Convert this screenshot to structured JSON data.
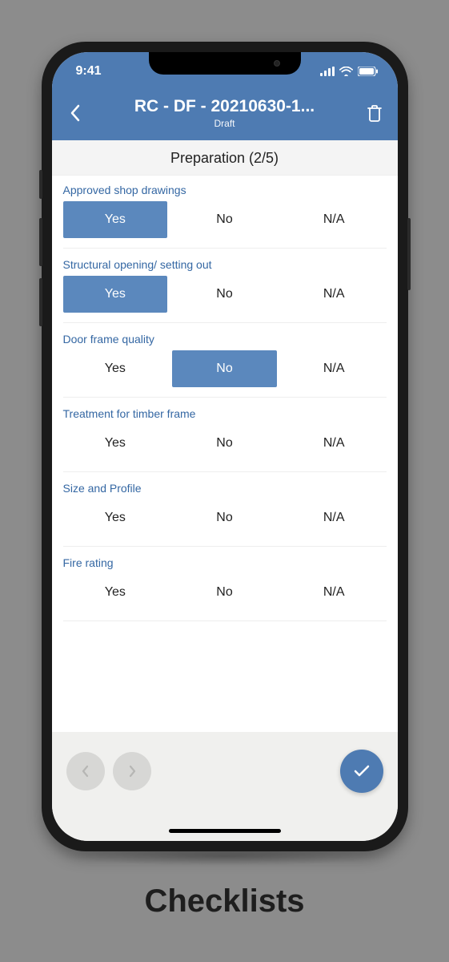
{
  "status": {
    "time": "9:41"
  },
  "header": {
    "title": "RC - DF - 20210630-1...",
    "subtitle": "Draft"
  },
  "section": {
    "title": "Preparation (2/5)"
  },
  "options": {
    "yes": "Yes",
    "no": "No",
    "na": "N/A"
  },
  "items": [
    {
      "label": "Approved shop drawings",
      "selected": "yes"
    },
    {
      "label": "Structural opening/ setting out",
      "selected": "yes"
    },
    {
      "label": "Door frame quality",
      "selected": "no"
    },
    {
      "label": "Treatment for timber frame",
      "selected": ""
    },
    {
      "label": "Size and Profile",
      "selected": ""
    },
    {
      "label": "Fire rating",
      "selected": ""
    }
  ],
  "caption": "Checklists"
}
